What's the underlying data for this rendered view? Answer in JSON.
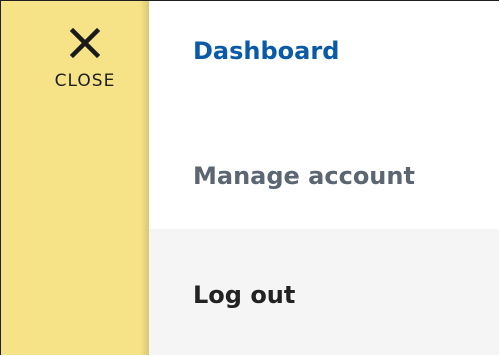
{
  "side_panel": {
    "close": {
      "icon": "close-icon",
      "label": "CLOSE"
    }
  },
  "menu": {
    "items": [
      {
        "label": "Dashboard"
      },
      {
        "label": "Manage account"
      },
      {
        "label": "Log out"
      }
    ]
  },
  "colors": {
    "panel": "#f7e387",
    "active_link": "#0a5aa8",
    "muted_link": "#5b6672",
    "hover_bg": "#f5f5f5"
  }
}
